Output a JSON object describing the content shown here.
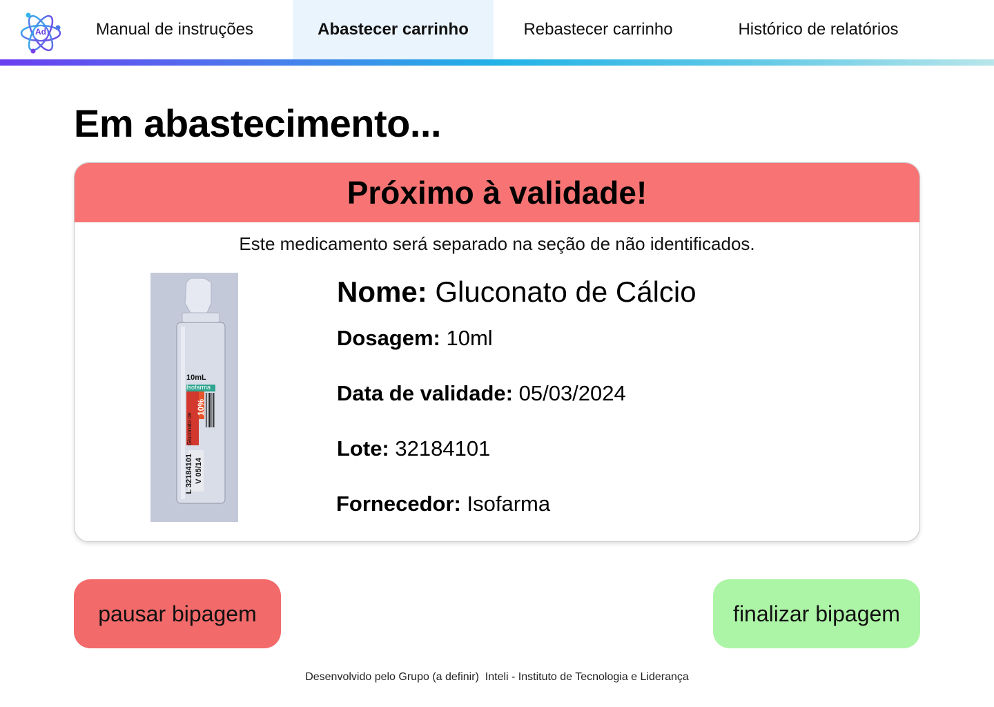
{
  "nav": {
    "logo_text": "Ad",
    "tabs": [
      {
        "label": "Manual de instruções"
      },
      {
        "label": "Abastecer carrinho"
      },
      {
        "label": "Rebastecer carrinho"
      },
      {
        "label": "Histórico de relatórios"
      }
    ],
    "active_tab": "Abastecer carrinho"
  },
  "page": {
    "title": "Em abastecimento..."
  },
  "alert": {
    "title": "Próximo à validade!",
    "message": "Este medicamento será separado na seção de não identificados."
  },
  "medication": {
    "fields": [
      {
        "label": "Nome:",
        "value": "Gluconato de Cálcio"
      },
      {
        "label": "Dosagem:",
        "value": "10ml"
      },
      {
        "label": "Data de validade:",
        "value": "05/03/2024"
      },
      {
        "label": "Lote:",
        "value": "32184101"
      },
      {
        "label": "Fornecedor:",
        "value": "Isofarma"
      }
    ],
    "photo": {
      "volume_text": "10mL",
      "brand_text": "Isofarma",
      "percent_text": "10%",
      "name_text": "Gluconato de Cálcio",
      "lot_text": "L 32184101",
      "expiry_text": "V 05/14"
    }
  },
  "actions": {
    "pause_label": "pausar bipagem",
    "finish_label": "finalizar bipagem"
  },
  "footer": {
    "text": "Desenvolvido pelo Grupo (a definir)  Inteli - Instituto de Tecnologia e Liderança"
  },
  "colors": {
    "alert_header": "#f87474",
    "pause_button": "#f36a6a",
    "finish_button": "#adf5a6",
    "active_tab_bg": "#eaf4fd"
  }
}
